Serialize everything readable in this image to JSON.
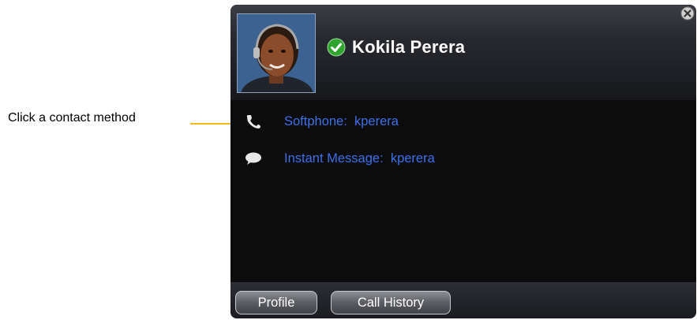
{
  "callout": {
    "text": "Click a contact method"
  },
  "contact": {
    "name": "Kokila Perera",
    "status": "available"
  },
  "methods": [
    {
      "icon": "phone-icon",
      "label": "Softphone:",
      "value": "kperera"
    },
    {
      "icon": "speech-bubble-icon",
      "label": "Instant Message:",
      "value": "kperera"
    }
  ],
  "footer": {
    "profile_label": "Profile",
    "history_label": "Call History"
  },
  "colors": {
    "link": "#3d6fe6",
    "status": "#2fa52f",
    "callout_line": "#f2b81e",
    "panel": "#0c0c0c"
  }
}
